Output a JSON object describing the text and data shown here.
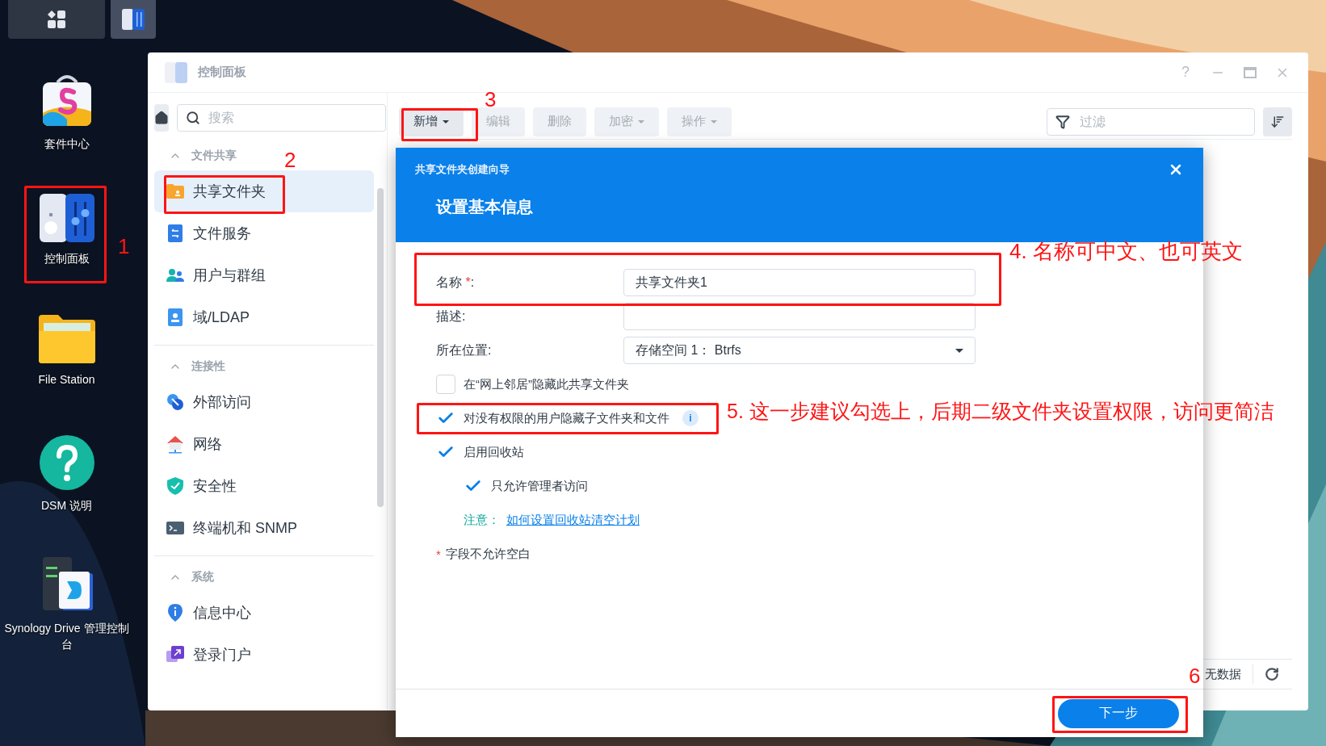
{
  "taskbar": {
    "buttons": [
      {
        "kind": "apps",
        "selected": false
      },
      {
        "kind": "control-panel",
        "selected": true
      }
    ]
  },
  "desktop": {
    "icons": [
      {
        "kind": "store",
        "label": "套件中心"
      },
      {
        "kind": "control-panel",
        "label": "控制面板"
      },
      {
        "kind": "folder",
        "label": "File Station"
      },
      {
        "kind": "help",
        "label": "DSM 说明"
      },
      {
        "kind": "drive",
        "label": "Synology Drive 管理控制台"
      }
    ]
  },
  "window": {
    "title": "控制面板",
    "help": "?"
  },
  "sidebar": {
    "search": {
      "placeholder": "搜索"
    },
    "groups": [
      {
        "title": "文件共享",
        "expanded": true,
        "items": [
          {
            "label": "共享文件夹",
            "selected": true
          },
          {
            "label": "文件服务",
            "selected": false
          },
          {
            "label": "用户与群组",
            "selected": false
          },
          {
            "label": "域/LDAP",
            "selected": false
          }
        ]
      },
      {
        "title": "连接性",
        "expanded": true,
        "items": [
          {
            "label": "外部访问",
            "selected": false
          },
          {
            "label": "网络",
            "selected": false
          },
          {
            "label": "安全性",
            "selected": false
          },
          {
            "label": "终端机和 SNMP",
            "selected": false
          }
        ]
      },
      {
        "title": "系统",
        "expanded": true,
        "items": [
          {
            "label": "信息中心",
            "selected": false
          },
          {
            "label": "登录门户",
            "selected": false
          }
        ]
      }
    ]
  },
  "toolbar": {
    "buttons": [
      {
        "label": "新增",
        "dropdown": true,
        "disabled": false
      },
      {
        "label": "编辑",
        "dropdown": false,
        "disabled": true
      },
      {
        "label": "删除",
        "dropdown": false,
        "disabled": true
      },
      {
        "label": "加密",
        "dropdown": true,
        "disabled": true
      },
      {
        "label": "操作",
        "dropdown": true,
        "disabled": true
      }
    ],
    "filter": {
      "placeholder": "过滤"
    }
  },
  "list": {
    "status": "无数据"
  },
  "dialog": {
    "title": "共享文件夹创建向导",
    "heading": "设置基本信息",
    "fields": [
      {
        "kind": "text",
        "label": "名称",
        "mark": "*",
        "colon": ":",
        "value": "共享文件夹1"
      },
      {
        "kind": "text",
        "label": "描述:"
      },
      {
        "kind": "select",
        "label": "所在位置:",
        "value": "存储空间 1： Btrfs"
      }
    ],
    "checkboxes": [
      {
        "label": "在“网上邻居”隐藏此共享文件夹",
        "checked": false
      },
      {
        "label": "对没有权限的用户隐藏子文件夹和文件",
        "checked": true,
        "info": "i"
      },
      {
        "label": "启用回收站",
        "checked": true,
        "children": [
          {
            "label": "只允许管理者访问",
            "checked": true
          }
        ]
      }
    ],
    "note": {
      "label": "注意：",
      "link": "如何设置回收站清空计划"
    },
    "footnote": {
      "mark": "*",
      "text": "字段不允许空白"
    },
    "next": "下一步"
  },
  "annotations": [
    {
      "kind": "box"
    },
    {
      "kind": "label",
      "text": "1"
    },
    {
      "kind": "box"
    },
    {
      "kind": "label",
      "text": "2"
    },
    {
      "kind": "box"
    },
    {
      "kind": "label",
      "text": "3"
    },
    {
      "kind": "box"
    },
    {
      "kind": "label",
      "text": "4. 名称可中文、也可英文"
    },
    {
      "kind": "box"
    },
    {
      "kind": "label",
      "text": "5. 这一步建议勾选上，后期二级文件夹设置权限，访问更简洁"
    },
    {
      "kind": "box"
    },
    {
      "kind": "label",
      "text": "6"
    }
  ]
}
